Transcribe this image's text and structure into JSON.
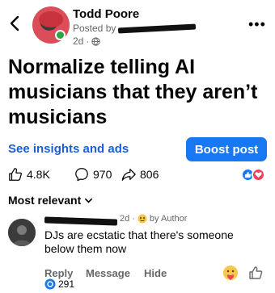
{
  "post": {
    "author": "Todd Poore",
    "posted_by_prefix": "Posted by",
    "age": "2d",
    "title": "Normalize telling AI musicians that they aren’t musicians",
    "insights_link": "See insights and ads",
    "boost_label": "Boost post",
    "likes_count": "4.8K",
    "comments_count": "970",
    "shares_count": "806"
  },
  "comments": {
    "sort_label": "Most relevant",
    "first": {
      "age": "2d",
      "badge": "by Author",
      "text": "DJs are ecstatic that there's someone below them now",
      "reply_label": "Reply",
      "message_label": "Message",
      "hide_label": "Hide",
      "reaction_count": "291"
    }
  },
  "colors": {
    "accent": "#1877f2",
    "link": "#1b5fd6",
    "secondary_text": "#65676b",
    "online": "#31a24c"
  }
}
